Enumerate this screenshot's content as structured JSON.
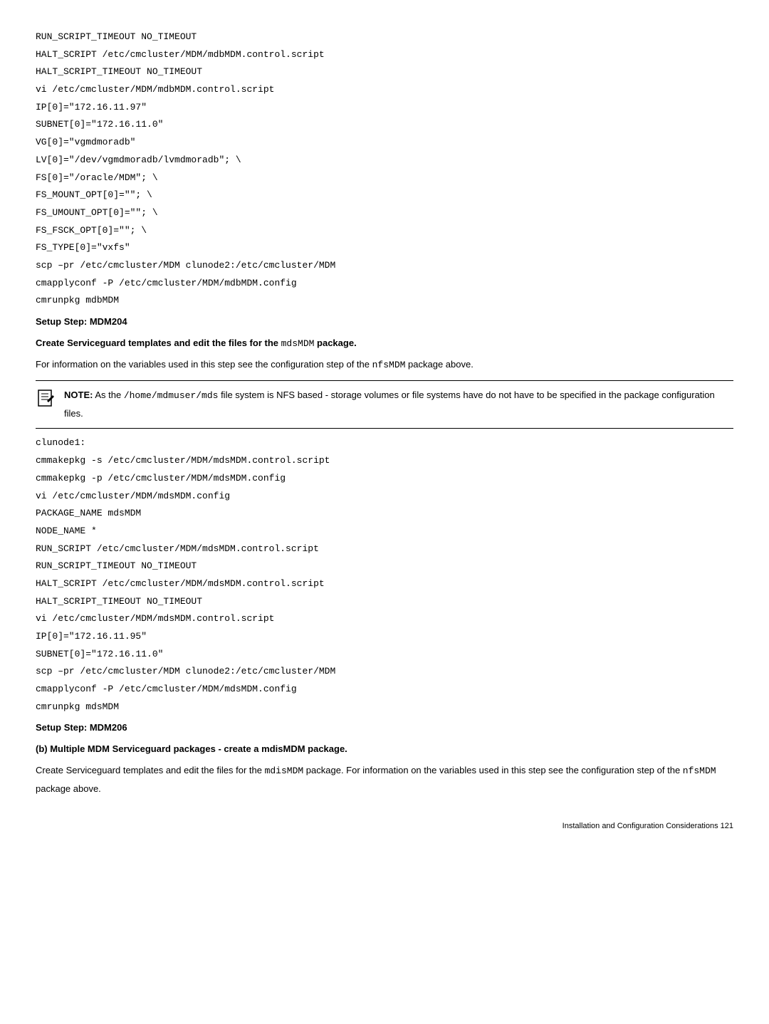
{
  "code_block_1": [
    "RUN_SCRIPT_TIMEOUT NO_TIMEOUT",
    "HALT_SCRIPT /etc/cmcluster/MDM/mdbMDM.control.script",
    "HALT_SCRIPT_TIMEOUT NO_TIMEOUT",
    "vi /etc/cmcluster/MDM/mdbMDM.control.script",
    "IP[0]=\"172.16.11.97\"",
    "SUBNET[0]=\"172.16.11.0\"",
    "VG[0]=\"vgmdmoradb\"",
    "LV[0]=\"/dev/vgmdmoradb/lvmdmoradb\"; \\",
    "FS[0]=\"/oracle/MDM\"; \\",
    "FS_MOUNT_OPT[0]=\"\"; \\",
    "FS_UMOUNT_OPT[0]=\"\"; \\",
    "FS_FSCK_OPT[0]=\"\"; \\",
    "FS_TYPE[0]=\"vxfs\"",
    "scp –pr /etc/cmcluster/MDM clunode2:/etc/cmcluster/MDM",
    "cmapplyconf -P /etc/cmcluster/MDM/mdbMDM.config",
    "cmrunpkg mdbMDM"
  ],
  "setup_step_1": "Setup Step: MDM204",
  "heading_1_prefix": "Create Serviceguard templates and edit the files for the ",
  "heading_1_code": "mdsMDM",
  "heading_1_suffix": " package.",
  "body_1_prefix": "For information on the variables used in this step see the configuration step of the ",
  "body_1_code": "nfsMDM",
  "body_1_suffix": " package above.",
  "note_label": "NOTE:",
  "note_prefix": "    As the ",
  "note_code": "/home/mdmuser/mds",
  "note_suffix": " file system is NFS based - storage volumes or file systems have do not have to be specified in the package configuration files.",
  "code_block_2": [
    "clunode1:",
    "cmmakepkg -s /etc/cmcluster/MDM/mdsMDM.control.script",
    "cmmakepkg -p /etc/cmcluster/MDM/mdsMDM.config",
    "vi /etc/cmcluster/MDM/mdsMDM.config",
    "PACKAGE_NAME mdsMDM",
    "NODE_NAME *",
    "RUN_SCRIPT /etc/cmcluster/MDM/mdsMDM.control.script",
    "RUN_SCRIPT_TIMEOUT NO_TIMEOUT",
    "HALT_SCRIPT /etc/cmcluster/MDM/mdsMDM.control.script",
    "HALT_SCRIPT_TIMEOUT NO_TIMEOUT",
    "vi /etc/cmcluster/MDM/mdsMDM.control.script",
    "IP[0]=\"172.16.11.95\"",
    "SUBNET[0]=\"172.16.11.0\"",
    "scp –pr /etc/cmcluster/MDM clunode2:/etc/cmcluster/MDM",
    "cmapplyconf -P /etc/cmcluster/MDM/mdsMDM.config",
    "cmrunpkg mdsMDM"
  ],
  "setup_step_2": "Setup Step: MDM206",
  "heading_2": "(b) Multiple MDM Serviceguard packages - create a mdisMDM package.",
  "body_2_prefix": "Create Serviceguard templates and edit the files for the ",
  "body_2_code_1": "mdisMDM",
  "body_2_mid": " package. For information on the variables used in this step see the configuration step of the ",
  "body_2_code_2": "nfsMDM",
  "body_2_suffix": " package above.",
  "footer": "Installation and Configuration Considerations    121"
}
